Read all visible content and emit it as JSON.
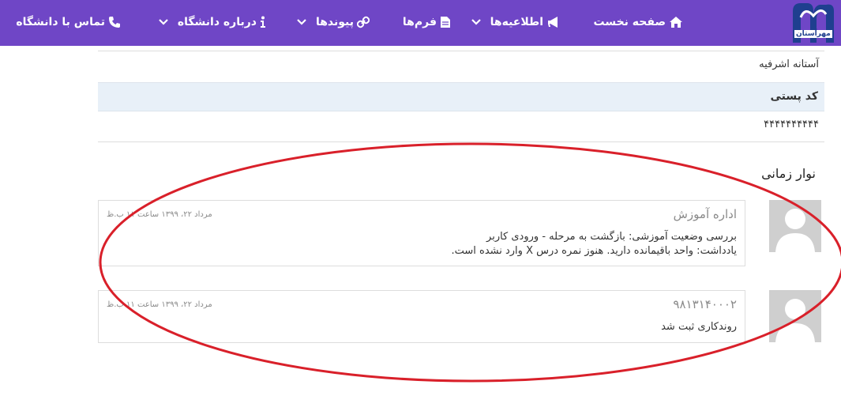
{
  "nav": {
    "items": [
      {
        "label": "صفحه نخست",
        "icon": "home-icon",
        "dropdown": false
      },
      {
        "label": "اطلاعیه‌ها",
        "icon": "megaphone-icon",
        "dropdown": true
      },
      {
        "label": "فرم‌ها",
        "icon": "document-icon",
        "dropdown": false
      },
      {
        "label": "پیوندها",
        "icon": "link-icon",
        "dropdown": true
      },
      {
        "label": "درباره دانشگاه",
        "icon": "info-icon",
        "dropdown": true
      },
      {
        "label": "تماس با دانشگاه",
        "icon": "phone-icon",
        "dropdown": false
      }
    ],
    "logo_text": "مهرآستان",
    "background": "#6f46c6"
  },
  "profile": {
    "address": "آستانه اشرفیه",
    "postal_code_label": "کد پستی",
    "postal_code_value": "۴۴۴۴۴۴۴۴۴۴"
  },
  "timeline": {
    "title": "نوار زمانی",
    "entries": [
      {
        "author": "اداره آموزش",
        "date": "مرداد ۲۲، ۱۳۹۹ ساعت ۱۱ ب.ظ",
        "lines": [
          "بررسی وضعیت آموزشی: بازگشت به مرحله - ورودی کاربر",
          "یادداشت: واحد باقیمانده دارید. هنوز نمره درس X وارد نشده است."
        ]
      },
      {
        "author": "۹۸۱۳۱۴۰۰۰۲",
        "date": "مرداد ۲۲، ۱۳۹۹ ساعت ۱۱ ب.ظ",
        "lines": [
          "روندکاری ثبت شد"
        ]
      }
    ]
  },
  "annotation_color": "#d9202a"
}
